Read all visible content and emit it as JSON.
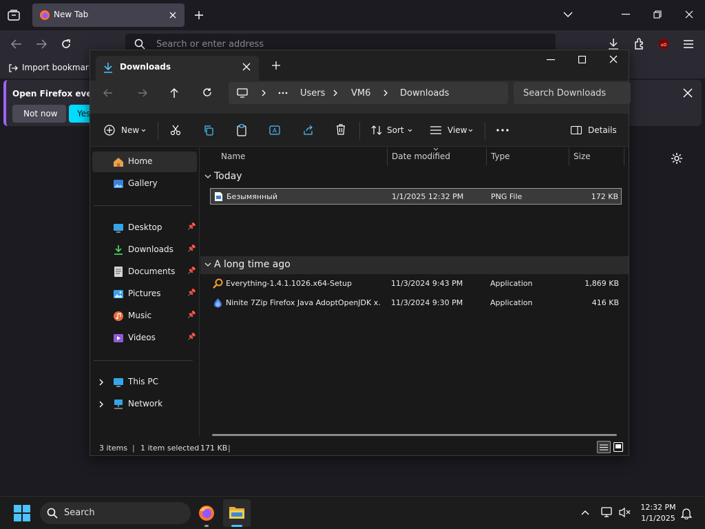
{
  "firefox": {
    "tab_title": "New Tab",
    "url_placeholder": "Search or enter address",
    "bookmark_import": "Import bookmarks",
    "notification_text": "Open Firefox every",
    "not_now": "Not now",
    "yes": "Yes,"
  },
  "explorer": {
    "tab_title": "Downloads",
    "breadcrumb": [
      "Users",
      "VM6",
      "Downloads"
    ],
    "search_placeholder": "Search Downloads",
    "toolbar": {
      "new": "New",
      "sort": "Sort",
      "view": "View",
      "details": "Details"
    },
    "sidebar": {
      "top": [
        {
          "label": "Home",
          "icon": "home-icon"
        },
        {
          "label": "Gallery",
          "icon": "gallery-icon"
        }
      ],
      "pinned": [
        {
          "label": "Desktop",
          "icon": "desktop-icon"
        },
        {
          "label": "Downloads",
          "icon": "downloads-icon"
        },
        {
          "label": "Documents",
          "icon": "documents-icon"
        },
        {
          "label": "Pictures",
          "icon": "pictures-icon"
        },
        {
          "label": "Music",
          "icon": "music-icon"
        },
        {
          "label": "Videos",
          "icon": "videos-icon"
        }
      ],
      "bottom": [
        {
          "label": "This PC",
          "icon": "this-pc-icon"
        },
        {
          "label": "Network",
          "icon": "network-icon"
        }
      ]
    },
    "columns": [
      "Name",
      "Date modified",
      "Type",
      "Size"
    ],
    "groups": [
      {
        "label": "Today",
        "files": [
          {
            "name": "Безымянный",
            "date": "1/1/2025 12:32 PM",
            "type": "PNG File",
            "size": "172 KB",
            "selected": true
          }
        ]
      },
      {
        "label": "A long time ago",
        "files": [
          {
            "name": "Everything-1.4.1.1026.x64-Setup",
            "date": "11/3/2024 9:43 PM",
            "type": "Application",
            "size": "1,869 KB"
          },
          {
            "name": "Ninite 7Zip Firefox Java AdoptOpenJDK x...",
            "date": "11/3/2024 9:30 PM",
            "type": "Application",
            "size": "416 KB"
          }
        ]
      }
    ],
    "status": {
      "items": "3 items",
      "selected": "1 item selected",
      "size": "171 KB"
    }
  },
  "taskbar": {
    "search": "Search",
    "time": "12:32 PM",
    "date": "1/1/2025"
  },
  "colors": {
    "accent": "#4cc2ff",
    "firefox_bg": "#1c1b22",
    "explorer_bg": "#191919"
  }
}
